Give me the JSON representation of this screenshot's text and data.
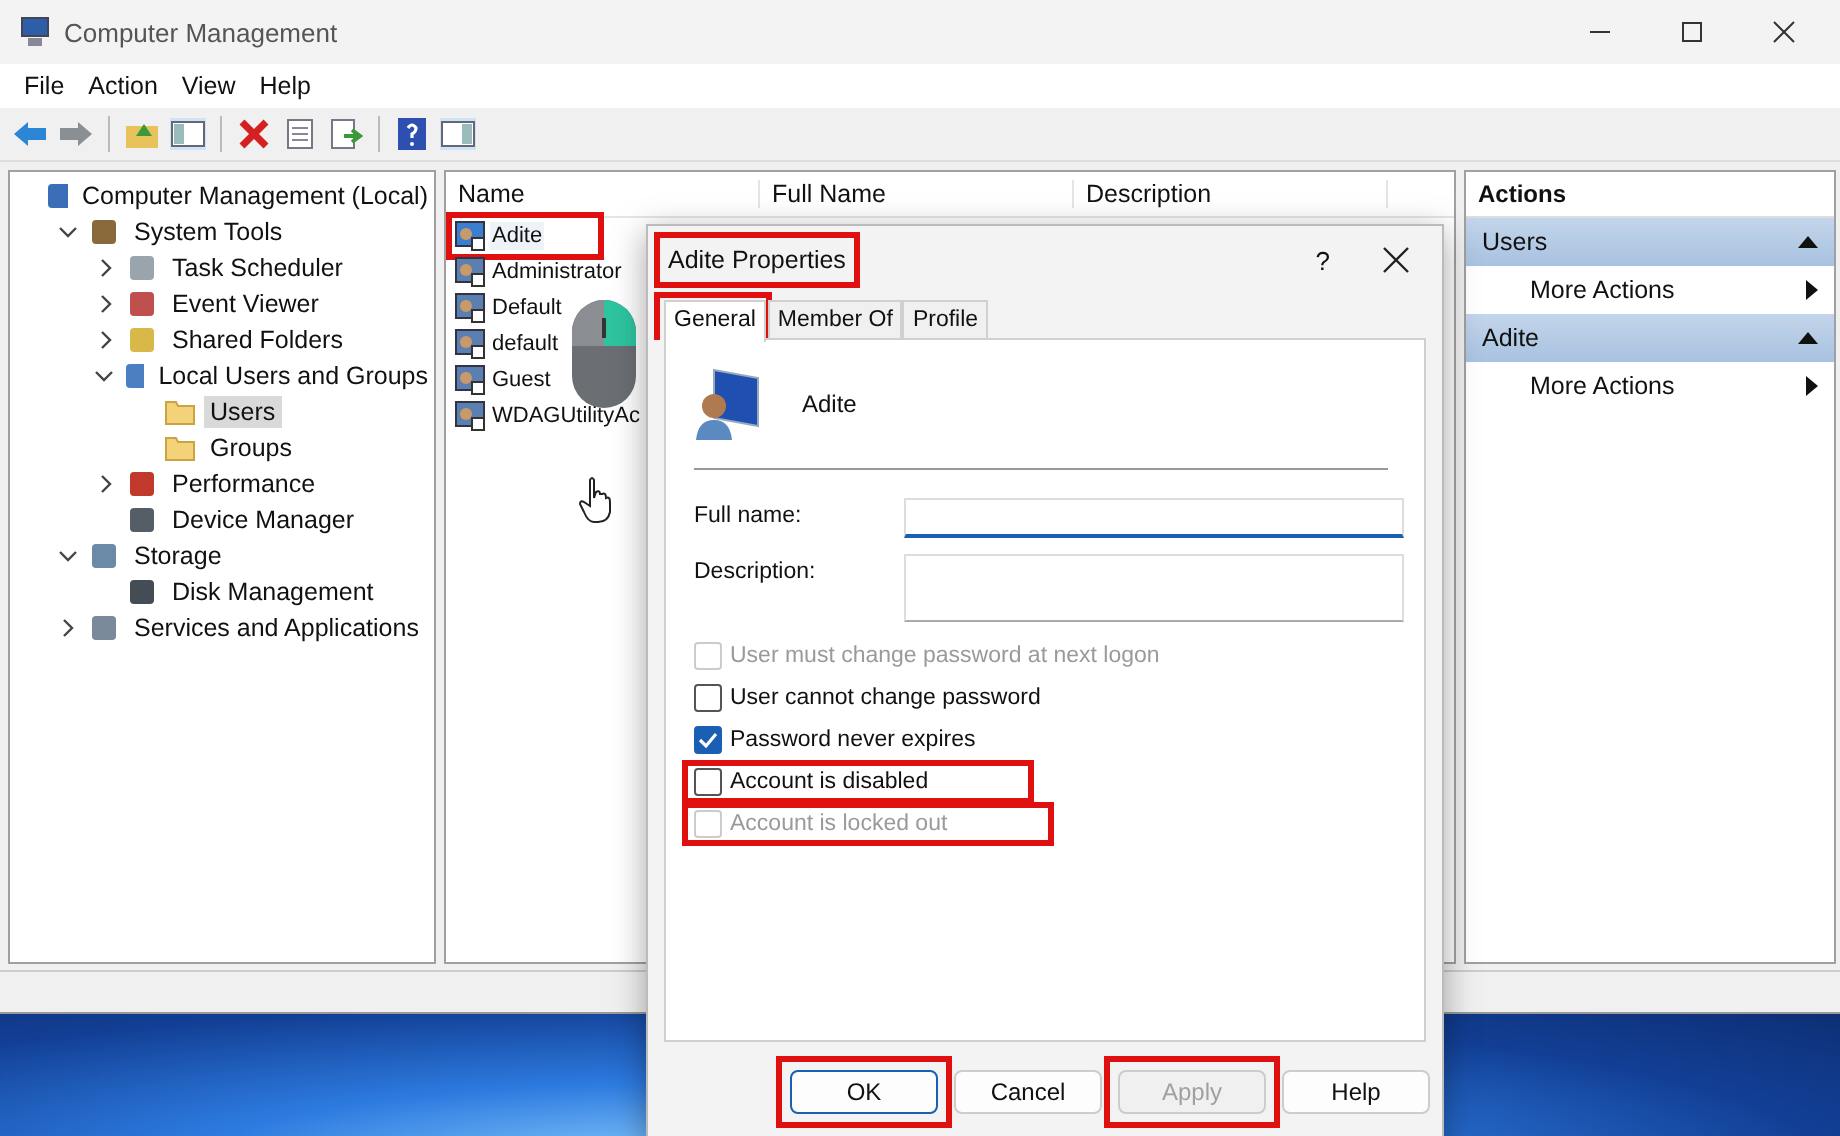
{
  "window": {
    "title": "Computer Management"
  },
  "menu": [
    "File",
    "Action",
    "View",
    "Help"
  ],
  "tree": [
    {
      "label": "Computer Management (Local)",
      "kind": "computer",
      "selected": false,
      "children": [
        {
          "label": "System Tools",
          "kind": "tools",
          "expanded": true,
          "selected": false,
          "children": [
            {
              "label": "Task Scheduler",
              "kind": "clock",
              "expanded": false,
              "selected": false
            },
            {
              "label": "Event Viewer",
              "kind": "log",
              "expanded": false,
              "selected": false
            },
            {
              "label": "Shared Folders",
              "kind": "share",
              "expanded": false,
              "selected": false
            },
            {
              "label": "Local Users and Groups",
              "kind": "users",
              "expanded": true,
              "selected": false,
              "children": [
                {
                  "label": "Users",
                  "kind": "folder",
                  "selected": true
                },
                {
                  "label": "Groups",
                  "kind": "folder",
                  "selected": false
                }
              ]
            },
            {
              "label": "Performance",
              "kind": "perf",
              "expanded": false,
              "selected": false
            },
            {
              "label": "Device Manager",
              "kind": "device",
              "selected": false
            }
          ]
        },
        {
          "label": "Storage",
          "kind": "storage",
          "expanded": true,
          "selected": false,
          "children": [
            {
              "label": "Disk Management",
              "kind": "disk",
              "selected": false
            }
          ]
        },
        {
          "label": "Services and Applications",
          "kind": "services",
          "expanded": false,
          "selected": false
        }
      ]
    }
  ],
  "list": {
    "columns": [
      "Name",
      "Full Name",
      "Description"
    ],
    "rows": [
      {
        "name": "Adite",
        "selected": true,
        "highlighted": true
      },
      {
        "name": "Administrator",
        "selected": false,
        "highlighted": false
      },
      {
        "name": "Default",
        "selected": false,
        "highlighted": false
      },
      {
        "name": "default",
        "selected": false,
        "highlighted": false
      },
      {
        "name": "Guest",
        "selected": false,
        "highlighted": false
      },
      {
        "name": "WDAGUtilityAc",
        "selected": false,
        "highlighted": false
      }
    ]
  },
  "actions": {
    "title": "Actions",
    "sections": [
      {
        "title": "Users",
        "items": [
          "More Actions"
        ]
      },
      {
        "title": "Adite",
        "items": [
          "More Actions"
        ]
      }
    ]
  },
  "dialog": {
    "title": "Adite Properties",
    "title_highlighted": true,
    "help": "?",
    "tabs": [
      {
        "label": "General",
        "selected": true,
        "highlighted": true
      },
      {
        "label": "Member Of",
        "selected": false,
        "highlighted": false
      },
      {
        "label": "Profile",
        "selected": false,
        "highlighted": false
      }
    ],
    "user_name": "Adite",
    "fields": [
      {
        "label": "Full name:",
        "focused": true
      },
      {
        "label": "Description:",
        "focused": false
      }
    ],
    "checkboxes": [
      {
        "label": "User must change password at next logon",
        "checked": false,
        "disabled": true,
        "highlighted": false
      },
      {
        "label": "User cannot change password",
        "checked": false,
        "disabled": false,
        "highlighted": false
      },
      {
        "label": "Password never expires",
        "checked": true,
        "disabled": false,
        "highlighted": false
      },
      {
        "label": "Account is disabled",
        "checked": false,
        "disabled": false,
        "highlighted": true
      },
      {
        "label": "Account is locked out",
        "checked": false,
        "disabled": true,
        "highlighted": true
      }
    ],
    "buttons": [
      {
        "label": "OK",
        "default": true,
        "disabled": false,
        "highlighted": true
      },
      {
        "label": "Cancel",
        "default": false,
        "disabled": false,
        "highlighted": false
      },
      {
        "label": "Apply",
        "default": false,
        "disabled": true,
        "highlighted": true
      },
      {
        "label": "Help",
        "default": false,
        "disabled": false,
        "highlighted": false
      }
    ]
  }
}
